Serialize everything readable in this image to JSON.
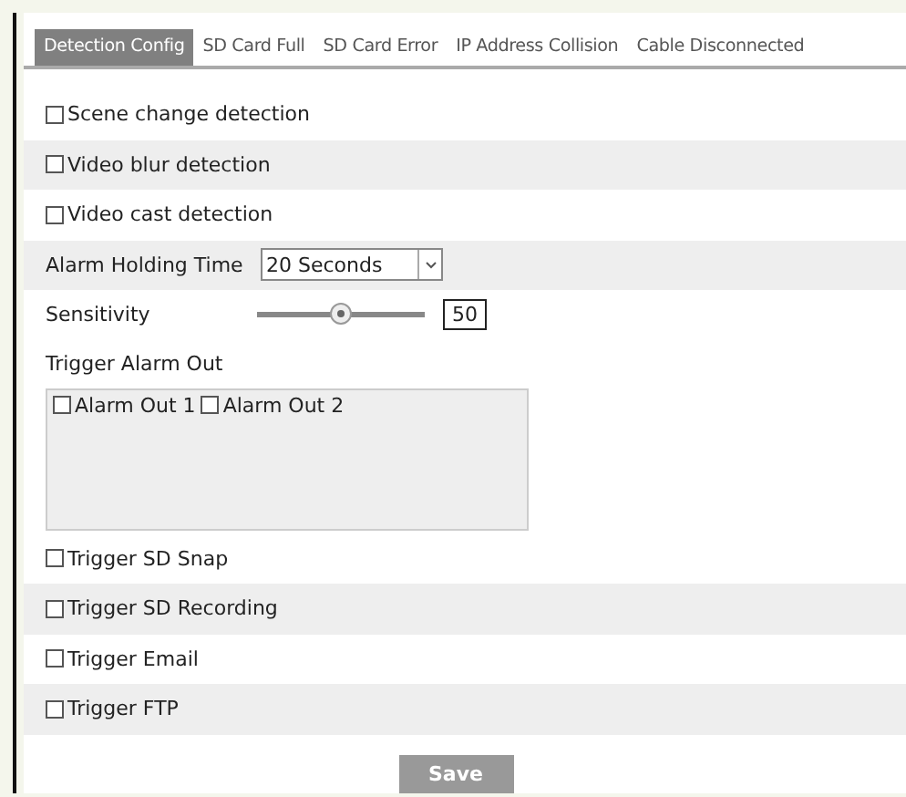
{
  "tabs": [
    {
      "label": "Detection Config",
      "selected": true
    },
    {
      "label": "SD Card Full",
      "selected": false
    },
    {
      "label": "SD Card Error",
      "selected": false
    },
    {
      "label": "IP Address Collision",
      "selected": false
    },
    {
      "label": "Cable Disconnected",
      "selected": false
    }
  ],
  "settings": [
    {
      "kind": "checkbox",
      "label": "Scene change detection",
      "checked": false
    },
    {
      "kind": "checkbox",
      "label": "Video blur detection",
      "checked": false
    },
    {
      "kind": "checkbox",
      "label": "Video cast detection",
      "checked": false
    },
    {
      "kind": "select",
      "label": "Alarm Holding Time",
      "value": "20 Seconds"
    },
    {
      "kind": "slider",
      "label": "Sensitivity",
      "level": 0.5,
      "reading": "50"
    }
  ],
  "trigger_alarm_out": {
    "title": "Trigger Alarm Out",
    "outputs": [
      {
        "label": "Alarm Out 1",
        "checked": false
      },
      {
        "label": "Alarm Out 2",
        "checked": false
      }
    ]
  },
  "triggers": [
    {
      "label": "Trigger SD Snap",
      "checked": false
    },
    {
      "label": "Trigger SD Recording",
      "checked": false
    },
    {
      "label": "Trigger Email",
      "checked": false
    },
    {
      "label": "Trigger FTP",
      "checked": false
    }
  ],
  "save_button": "Save"
}
